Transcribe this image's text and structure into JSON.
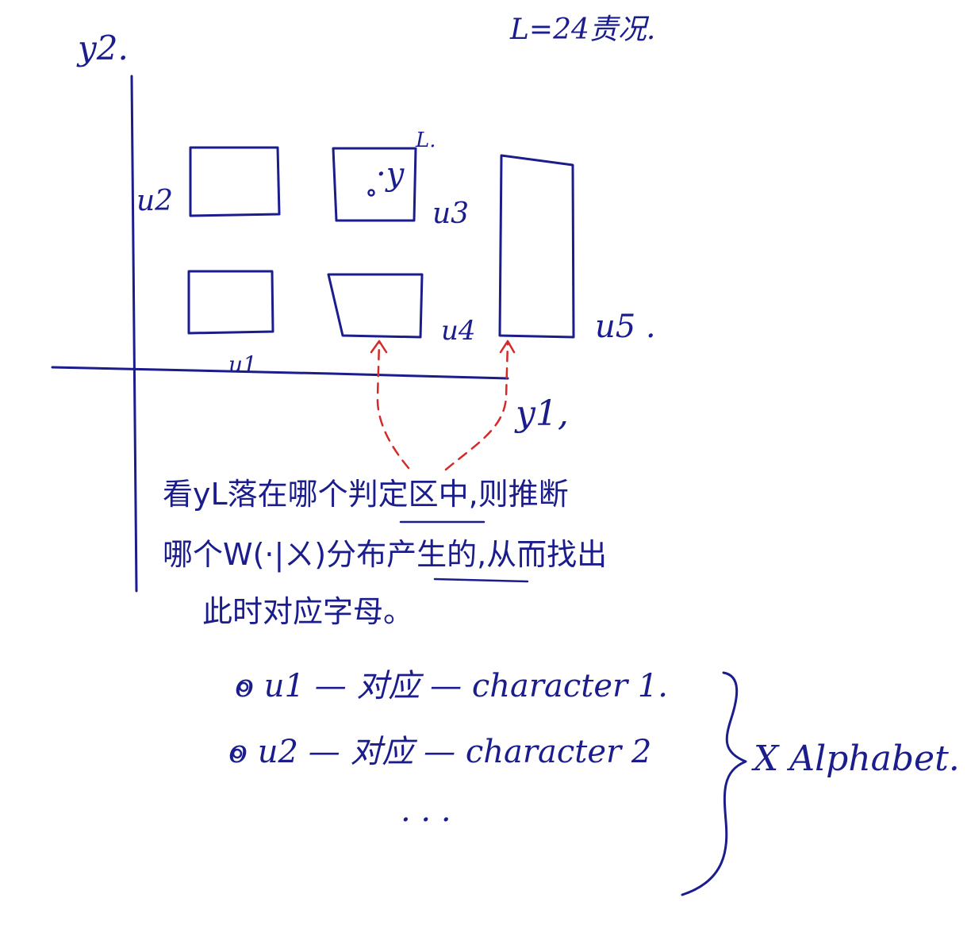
{
  "labels": {
    "y2_axis": "y2.",
    "case_note": "L=24责况.",
    "u1": "u1",
    "u2": "u2",
    "u3": "u3",
    "u4": "u4",
    "u5": "u5 .",
    "point_y": "·y",
    "superscript_L": "L.",
    "y1_axis": "y1,"
  },
  "note": {
    "line1": "看yL落在哪个判定区中,则推断",
    "line2": "哪个W(·|ㄨ)分布产生的,从而找出",
    "line3": "此时对应字母。"
  },
  "mapping": {
    "row1": "o u1 — 对应 — character 1.",
    "row2": "o u2 — 对应 — character 2",
    "ellipsis": ". . .",
    "brace_label": "X Alphabet."
  },
  "colors": {
    "ink": "#1c1d8c",
    "arrow": "#d42a2a"
  }
}
